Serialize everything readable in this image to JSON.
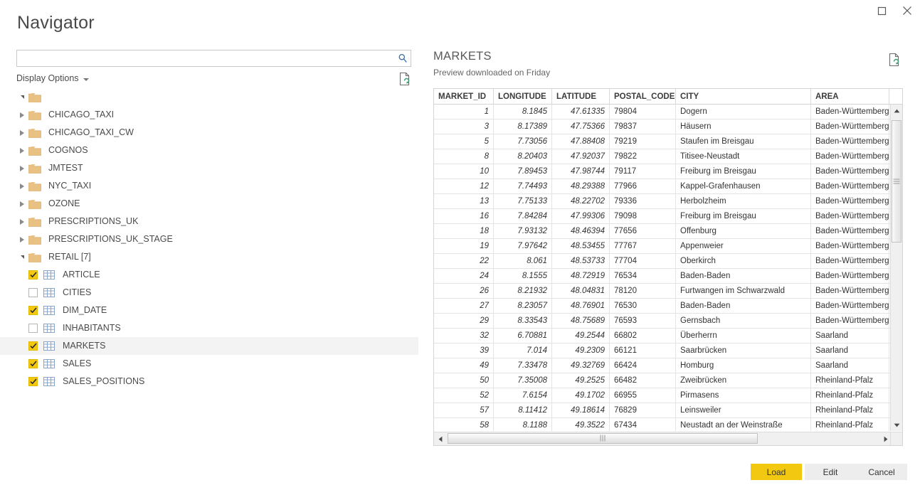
{
  "window": {
    "title": "Navigator",
    "controls": [
      {
        "name": "maximize-button",
        "glyph": "maximize"
      },
      {
        "name": "close-button",
        "glyph": "close"
      }
    ]
  },
  "search": {
    "value": "",
    "placeholder": "",
    "icon": "search-icon"
  },
  "display_options": {
    "label": "Display Options",
    "caret_icon": "chevron-down-icon",
    "refresh_icon": "refresh-document-icon"
  },
  "tree": {
    "root": {
      "label": "",
      "expanded": true,
      "icon": "folder-icon"
    },
    "items": [
      {
        "label": "CHICAGO_TAXI",
        "type": "folder",
        "expanded": false,
        "indent": 1
      },
      {
        "label": "CHICAGO_TAXI_CW",
        "type": "folder",
        "expanded": false,
        "indent": 1
      },
      {
        "label": "COGNOS",
        "type": "folder",
        "expanded": false,
        "indent": 1
      },
      {
        "label": "JMTEST",
        "type": "folder",
        "expanded": false,
        "indent": 1
      },
      {
        "label": "NYC_TAXI",
        "type": "folder",
        "expanded": false,
        "indent": 1
      },
      {
        "label": "OZONE",
        "type": "folder",
        "expanded": false,
        "indent": 1
      },
      {
        "label": "PRESCRIPTIONS_UK",
        "type": "folder",
        "expanded": false,
        "indent": 1
      },
      {
        "label": "PRESCRIPTIONS_UK_STAGE",
        "type": "folder",
        "expanded": false,
        "indent": 1
      },
      {
        "label": "RETAIL [7]",
        "type": "folder",
        "expanded": true,
        "indent": 1
      },
      {
        "label": "ARTICLE",
        "type": "table",
        "checked": true,
        "selected": false,
        "indent": 2
      },
      {
        "label": "CITIES",
        "type": "table",
        "checked": false,
        "selected": false,
        "indent": 2
      },
      {
        "label": "DIM_DATE",
        "type": "table",
        "checked": true,
        "selected": false,
        "indent": 2
      },
      {
        "label": "INHABITANTS",
        "type": "table",
        "checked": false,
        "selected": false,
        "indent": 2
      },
      {
        "label": "MARKETS",
        "type": "table",
        "checked": true,
        "selected": true,
        "indent": 2
      },
      {
        "label": "SALES",
        "type": "table",
        "checked": true,
        "selected": false,
        "indent": 2
      },
      {
        "label": "SALES_POSITIONS",
        "type": "table",
        "checked": true,
        "selected": false,
        "indent": 2
      }
    ]
  },
  "preview": {
    "title": "MARKETS",
    "subtitle": "Preview downloaded on Friday",
    "refresh_icon": "refresh-document-icon",
    "columns": [
      "MARKET_ID",
      "LONGITUDE",
      "LATITUDE",
      "POSTAL_CODE",
      "CITY",
      "AREA"
    ],
    "rows": [
      [
        "1",
        "8.1845",
        "47.61335",
        "79804",
        "Dogern",
        "Baden-Württemberg"
      ],
      [
        "3",
        "8.17389",
        "47.75366",
        "79837",
        "Häusern",
        "Baden-Württemberg"
      ],
      [
        "5",
        "7.73056",
        "47.88408",
        "79219",
        "Staufen im Breisgau",
        "Baden-Württemberg"
      ],
      [
        "8",
        "8.20403",
        "47.92037",
        "79822",
        "Titisee-Neustadt",
        "Baden-Württemberg"
      ],
      [
        "10",
        "7.89453",
        "47.98744",
        "79117",
        "Freiburg im Breisgau",
        "Baden-Württemberg"
      ],
      [
        "12",
        "7.74493",
        "48.29388",
        "77966",
        "Kappel-Grafenhausen",
        "Baden-Württemberg"
      ],
      [
        "13",
        "7.75133",
        "48.22702",
        "79336",
        "Herbolzheim",
        "Baden-Württemberg"
      ],
      [
        "16",
        "7.84284",
        "47.99306",
        "79098",
        "Freiburg im Breisgau",
        "Baden-Württemberg"
      ],
      [
        "18",
        "7.93132",
        "48.46394",
        "77656",
        "Offenburg",
        "Baden-Württemberg"
      ],
      [
        "19",
        "7.97642",
        "48.53455",
        "77767",
        "Appenweier",
        "Baden-Württemberg"
      ],
      [
        "22",
        "8.061",
        "48.53733",
        "77704",
        "Oberkirch",
        "Baden-Württemberg"
      ],
      [
        "24",
        "8.1555",
        "48.72919",
        "76534",
        "Baden-Baden",
        "Baden-Württemberg"
      ],
      [
        "26",
        "8.21932",
        "48.04831",
        "78120",
        "Furtwangen im Schwarzwald",
        "Baden-Württemberg"
      ],
      [
        "27",
        "8.23057",
        "48.76901",
        "76530",
        "Baden-Baden",
        "Baden-Württemberg"
      ],
      [
        "29",
        "8.33543",
        "48.75689",
        "76593",
        "Gernsbach",
        "Baden-Württemberg"
      ],
      [
        "32",
        "6.70881",
        "49.2544",
        "66802",
        "Überherrn",
        "Saarland"
      ],
      [
        "39",
        "7.014",
        "49.2309",
        "66121",
        "Saarbrücken",
        "Saarland"
      ],
      [
        "49",
        "7.33478",
        "49.32769",
        "66424",
        "Homburg",
        "Saarland"
      ],
      [
        "50",
        "7.35008",
        "49.2525",
        "66482",
        "Zweibrücken",
        "Rheinland-Pfalz"
      ],
      [
        "52",
        "7.6154",
        "49.1702",
        "66955",
        "Pirmasens",
        "Rheinland-Pfalz"
      ],
      [
        "57",
        "8.11412",
        "49.18614",
        "76829",
        "Leinsweiler",
        "Rheinland-Pfalz"
      ],
      [
        "58",
        "8.1188",
        "49.3522",
        "67434",
        "Neustadt an der Weinstraße",
        "Rheinland-Pfalz"
      ]
    ]
  },
  "footer": {
    "load_label": "Load",
    "edit_label": "Edit",
    "cancel_label": "Cancel"
  },
  "colors": {
    "accent": "#f2c811",
    "folder": "#e9c183",
    "text": "#4a4a4a",
    "selected_row": "#f3f3f3"
  }
}
